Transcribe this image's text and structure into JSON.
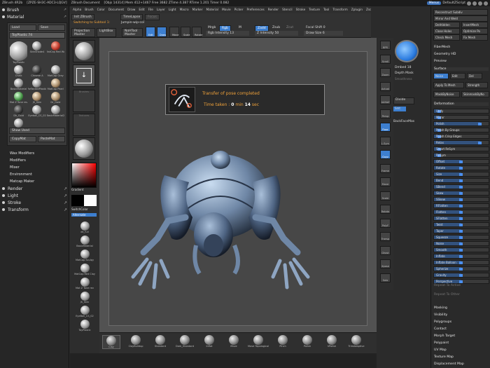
{
  "title_bar": {
    "app": "ZBrush 4R2b",
    "ids": "[ZPZE-SH3C-ADC3-LQGV]",
    "doc": "ZBrush Document",
    "stats": "[Objs 14314]  Mem 412+1467  Free 3682  ZTime 4.387  RTime 1.201  Timer 0.082",
    "menus_btn": "Menus",
    "script_btn": "DefaultZScript"
  },
  "menubar": [
    "Alpha",
    "Brush",
    "Color",
    "Document",
    "Draw",
    "Edit",
    "File",
    "Layer",
    "Light",
    "Macro",
    "Marker",
    "Material",
    "Movie",
    "Picker",
    "Preferences",
    "Render",
    "Stencil",
    "Stroke",
    "Texture",
    "Tool",
    "Transform",
    "Zplugin",
    "Zscript"
  ],
  "top_shelf": {
    "init": "Init ZBrush",
    "timelapse": "TimeLapse",
    "focus": "Focus",
    "switching": "Switching to Subtool 1:",
    "subtool_name": "Jumpin-wip-col",
    "projection": "Projection Master",
    "lightbox": "LightBox",
    "quicksketch": "NoHTool Master",
    "edit": "Edit",
    "draw": "Draw",
    "move": "Move",
    "scale": "Scale",
    "rotate": "Rotate",
    "mrgb": "Mrgb",
    "rgb": "Rgb",
    "m": "M",
    "rgb_intensity_label": "Rgb Intensity",
    "rgb_intensity": "13",
    "zadd": "Zadd",
    "zsub": "Zsub",
    "zcut": "Zcut",
    "z_intensity_label": "Z Intensity",
    "z_intensity": "50",
    "focal_shift_label": "Focal Shift",
    "focal_shift": "0",
    "draw_size_label": "Draw Size",
    "draw_size": "6"
  },
  "left_panel": {
    "brush": "Brush",
    "material": "Material",
    "load": "Load",
    "save": "Save",
    "current_mat": "ToyPlastic",
    "current_num": "74",
    "materials": [
      {
        "name": "ToyPlastic",
        "c": "big"
      },
      {
        "name": "SkinShade4",
        "c": ""
      },
      {
        "name": "MatCap Red Wa",
        "c": "red"
      },
      {
        "name": "Chalk",
        "c": ""
      },
      {
        "name": "Chrome A",
        "c": "dark"
      },
      {
        "name": "MatCap Gray",
        "c": ""
      },
      {
        "name": "BasicMaterial",
        "c": ""
      },
      {
        "name": "ReflectedPlastic",
        "c": ""
      },
      {
        "name": "MatCap Pearl",
        "c": "warm"
      },
      {
        "name": "Mat Z Tone rev",
        "c": "green"
      },
      {
        "name": "JS_Skin",
        "c": "warm"
      },
      {
        "name": "Dr_Gold",
        "c": "warm"
      },
      {
        "name": "Dk_Gold",
        "c": "dark"
      },
      {
        "name": "Eyeball_CS_02",
        "c": ""
      },
      {
        "name": "BasicMaterial2",
        "c": ""
      },
      {
        "name": "ReflectedMap",
        "c": ""
      }
    ],
    "show_used": "Show Used",
    "copymat": "CopyMat",
    "pastemat": "PasteMat",
    "sub_items": [
      "Wax Modifiers",
      "Modifiers",
      "Mixer",
      "Environment",
      "Matcap Maker"
    ],
    "groups": [
      "Render",
      "Light",
      "Stroke",
      "Transform"
    ]
  },
  "left_shelf": {
    "gradient": "Gradient",
    "switch_color": "SwitchColor",
    "alternate": "Alternate",
    "mats": [
      "dk_full",
      "BasicMaterial",
      "MatCap Sculpy",
      "MatCap Red Clay",
      "Mat Z Tone rev",
      "JS_Skin",
      "EyeBall_CS_02",
      "ToyPlastic"
    ],
    "thumb_labels": [
      "",
      "",
      "Brushes",
      "",
      "Textures",
      "Alpha",
      "Strokes Dot"
    ]
  },
  "notification": {
    "title": "Transfer of pose completed",
    "time_label": "Time taken :",
    "minutes": "0",
    "min_word": "min",
    "seconds": "14",
    "sec_word": "sec"
  },
  "brushes": [
    "Clay",
    "ClayBuildup",
    "Standard",
    "Dam_Standard",
    "Inflat",
    "Move",
    "Move Topological",
    "Pinch",
    "Polish",
    "hPolish",
    "TrimAdaptive"
  ],
  "right_shelf": [
    "BPR",
    "Scroll",
    "Zoom",
    "Actual",
    "AAHalf",
    "Persp",
    "Floor",
    "L.Sym",
    "Gxyz",
    "Frame",
    "Move",
    "Scale",
    "Rotate",
    "PolyF",
    "Transp",
    "Ghost",
    "Xpose",
    "Solo"
  ],
  "nav": {
    "dynamesh": "Dmbed",
    "dmval": "18",
    "depth_mask": "Depth Mask",
    "smoothen": "Smoothness",
    "divide": "Divide",
    "backface": "BackFaceMas",
    "smt": "Smt"
  },
  "right_panel": {
    "top_buttons": [
      "Reconstruct Subdiv",
      "Mirror And Weld",
      "DelHidden",
      "InsertMesh",
      "Close Holes",
      "Optimize Po",
      "Check Mesh",
      "Fix Mesh"
    ],
    "fibermesh": "FiberMesh",
    "geometry_hd": "Geometry HD",
    "preview": "Preview",
    "surface": "Surface",
    "noise": "Noise",
    "edit": "Edit",
    "del": "Del",
    "apply_to_mesh": "Apply To Mesh",
    "strength": "Strength",
    "maskbynoise": "MaskByNoise",
    "skinmask": "SkinmaskByNo",
    "deformation": "Deformation",
    "deform_items": [
      {
        "label": "Unify",
        "v": 0.1
      },
      {
        "label": "Mirror",
        "v": 0.1
      },
      {
        "label": "Polish",
        "v": 0.85
      },
      {
        "label": "Polish By Groups",
        "v": 0.1
      },
      {
        "label": "Polish Crisp Edges",
        "v": 0.1
      },
      {
        "label": "Relax",
        "v": 0.85
      },
      {
        "label": "Smart ReSym",
        "v": 0.1
      },
      {
        "label": "ReSym",
        "v": 0.1
      },
      {
        "label": "Offset",
        "v": 0.5
      },
      {
        "label": "Rotate",
        "v": 0.5
      },
      {
        "label": "Size",
        "v": 0.5
      },
      {
        "label": "Bend",
        "v": 0.5
      },
      {
        "label": "SBend",
        "v": 0.5
      },
      {
        "label": "Skew",
        "v": 0.5
      },
      {
        "label": "SSkew",
        "v": 0.5
      },
      {
        "label": "RFlatten",
        "v": 0.5
      },
      {
        "label": "Flatten",
        "v": 0.5
      },
      {
        "label": "SFlatten",
        "v": 0.5
      },
      {
        "label": "Twist",
        "v": 0.5
      },
      {
        "label": "Taper",
        "v": 0.5
      },
      {
        "label": "Squeeze",
        "v": 0.5
      },
      {
        "label": "Noise",
        "v": 0.5
      },
      {
        "label": "Smooth",
        "v": 0.5
      },
      {
        "label": "Inflate",
        "v": 0.5
      },
      {
        "label": "Inflate Balloon",
        "v": 0.5
      },
      {
        "label": "Spherize",
        "v": 0.5
      },
      {
        "label": "Gravity",
        "v": 0.5
      },
      {
        "label": "Perspective",
        "v": 0.5
      }
    ],
    "repeat_active": "Repeat To Active",
    "repeat_other": "Repeat To Other",
    "bottom_list": [
      "Masking",
      "Visibility",
      "Polygroups",
      "Contact",
      "Morph Target",
      "Polypaint",
      "UV Map",
      "Texture Map",
      "Displacement Map"
    ]
  }
}
